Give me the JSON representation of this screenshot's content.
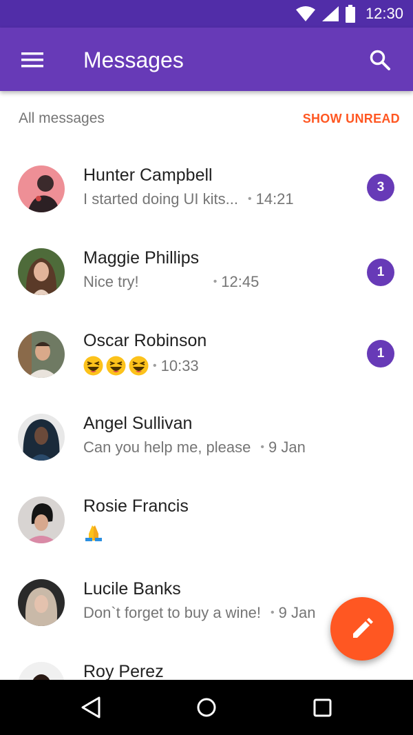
{
  "status_bar": {
    "time": "12:30",
    "icons": [
      "wifi-icon",
      "signal-icon",
      "battery-icon"
    ]
  },
  "app_bar": {
    "title": "Messages",
    "menu_icon": "menu-icon",
    "search_icon": "search-icon",
    "color": "#673ab7",
    "status_color": "#512da8"
  },
  "filter": {
    "label": "All messages",
    "action": "SHOW UNREAD",
    "action_color": "#ff5722"
  },
  "conversations": [
    {
      "name": "Hunter Campbell",
      "message": "I started doing UI kits...",
      "time": "14:21",
      "unread": "3"
    },
    {
      "name": "Maggie Phillips",
      "message": "Nice try!",
      "time": "12:45",
      "unread": "1"
    },
    {
      "name": "Oscar Robinson",
      "message": "😆😆😆",
      "time": "10:33",
      "unread": "1"
    },
    {
      "name": "Angel Sullivan",
      "message": "Can you help me, please",
      "time": "9 Jan",
      "unread": ""
    },
    {
      "name": "Rosie Francis",
      "message": "🙏",
      "time": "",
      "unread": ""
    },
    {
      "name": "Lucile Banks",
      "message": "Don`t forget to buy a wine!",
      "time": "9 Jan",
      "unread": ""
    },
    {
      "name": "Roy Perez",
      "message": "",
      "time": "",
      "unread": ""
    }
  ],
  "fab": {
    "icon": "pencil-icon",
    "color": "#ff5722"
  },
  "nav_bar": {
    "icons": [
      "back-icon",
      "home-icon",
      "recents-icon"
    ]
  }
}
